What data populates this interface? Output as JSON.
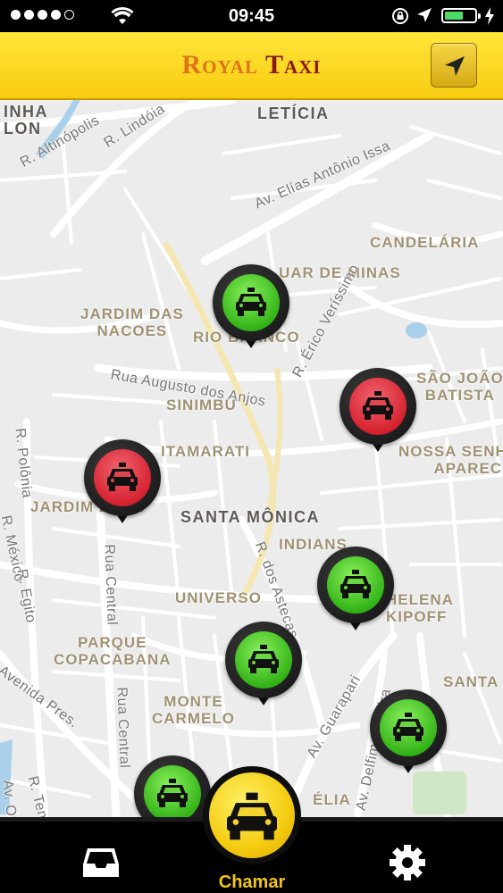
{
  "status_bar": {
    "time": "09:45"
  },
  "header": {
    "logo_part1": "Royal",
    "logo_part2": "Taxi",
    "locate_icon": "navigation-arrow-icon"
  },
  "map": {
    "labels": {
      "inha_lon": "INHA\nLON",
      "leticia": "LETÍCIA",
      "altinopolis": "R. Altinópolis",
      "lindoia": "R. Lindóia",
      "elias": "Av. Elías Antônio Issa",
      "candelaria": "CANDELÁRIA",
      "minas": "UAR DE MINAS",
      "jardim_nacoes": "JARDIM DAS\nNACOES",
      "rio_branco": "RIO BRANCO",
      "erico": "R. Érico Veríssimo",
      "augusto": "Rua Augusto dos Anjos",
      "sao_joao": "SÃO JOÃO\nBATISTA",
      "sinimbu": "SINIMBU",
      "itamarati": "ITAMARATI",
      "nossa_senhora": "NOSSA SENH\nAPARECI",
      "polonia": "R. Polônia",
      "jardim_leon": "JARDIM LEON",
      "santa_monica": "SANTA MÔNICA",
      "mexico": "R. México",
      "astecas": "R. dos Astecas",
      "indians": "INDIANS",
      "rua_central_1": "Rua Central",
      "egito": "R. Egito",
      "universo": "UNIVERSO",
      "helena": "HELENA\nKIPOFF",
      "parque": "PARQUE\nCOPACABANA",
      "santa": "SANTA",
      "avenida_pres": "Avenida Pres.",
      "rua_central_2": "Rua Central",
      "monte_carmelo": "MONTE\nCARMELO",
      "guarapari": "Av. Guarapari",
      "delfim": "Av. Delfim Moreira",
      "r_tenente": "R. Ten",
      "av_ot": "Av. Ot",
      "amelia": "ÉLIA"
    },
    "pins": [
      {
        "status": "available",
        "color": "#3cbd1e"
      },
      {
        "status": "busy",
        "color": "#d62230"
      },
      {
        "status": "busy",
        "color": "#d62230"
      },
      {
        "status": "available",
        "color": "#3cbd1e"
      },
      {
        "status": "available",
        "color": "#3cbd1e"
      },
      {
        "status": "available",
        "color": "#3cbd1e"
      },
      {
        "status": "available",
        "color": "#3cbd1e"
      }
    ]
  },
  "tabbar": {
    "inbox_icon": "inbox-tray-icon",
    "settings_icon": "gear-icon",
    "call_label": "Chamar"
  },
  "colors": {
    "header_yellow": "#f7cb10",
    "logo_orange": "#e0731a",
    "logo_red": "#8a1812",
    "call_label": "#f2c51a"
  }
}
